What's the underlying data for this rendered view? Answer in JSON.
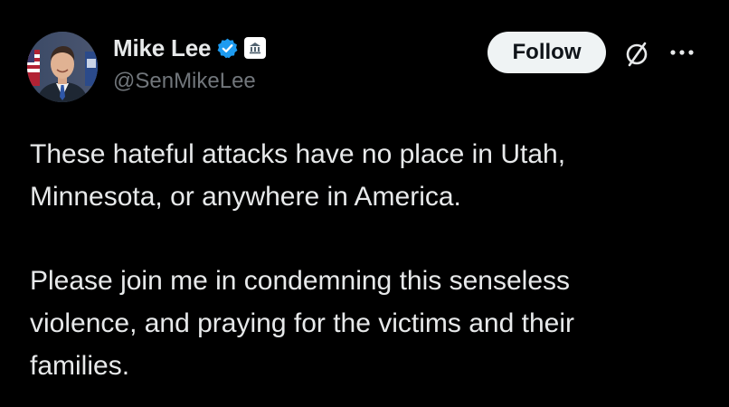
{
  "author": {
    "display_name": "Mike Lee",
    "handle": "@SenMikeLee",
    "verified": true,
    "verified_color": "#1d9bf0",
    "affiliation_badge_icon": "government-building-icon"
  },
  "actions": {
    "follow_label": "Follow",
    "grok_icon": "grok-icon",
    "more_icon": "more-options-icon"
  },
  "tweet": {
    "paragraphs": [
      "These hateful attacks have no place in Utah,\nMinnesota, or anywhere in America.",
      "Please join me in condemning this senseless\nviolence, and praying for the victims and their\nfamilies."
    ]
  },
  "colors": {
    "background": "#000000",
    "text_primary": "#e7e9ea",
    "text_secondary": "#71767b",
    "button_bg": "#eff3f4",
    "button_text": "#0f1419"
  }
}
